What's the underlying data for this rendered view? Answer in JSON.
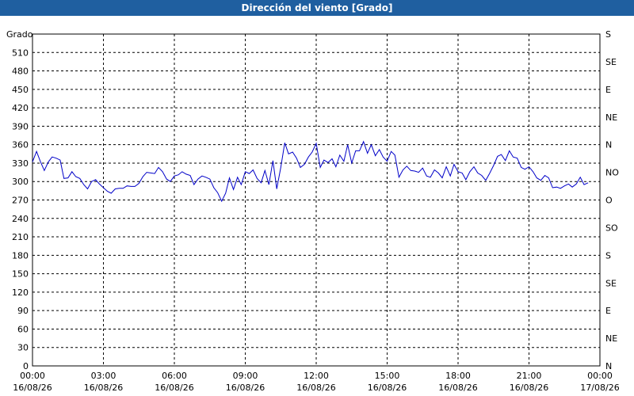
{
  "window": {
    "title": "Dirección del viento [Grado]"
  },
  "chart_data": {
    "type": "line",
    "ylabel": "Grado",
    "ylim": [
      0,
      540
    ],
    "yticks": [
      0,
      30,
      60,
      90,
      120,
      150,
      180,
      210,
      240,
      270,
      300,
      330,
      360,
      390,
      420,
      450,
      480,
      510
    ],
    "xlim": [
      0,
      24
    ],
    "x_unit": "hours since 16/08/26 00:00",
    "xticks": [
      {
        "x": 0,
        "time": "00:00",
        "date": "16/08/26"
      },
      {
        "x": 3,
        "time": "03:00",
        "date": "16/08/26"
      },
      {
        "x": 6,
        "time": "06:00",
        "date": "16/08/26"
      },
      {
        "x": 9,
        "time": "09:00",
        "date": "16/08/26"
      },
      {
        "x": 12,
        "time": "12:00",
        "date": "16/08/26"
      },
      {
        "x": 15,
        "time": "15:00",
        "date": "16/08/26"
      },
      {
        "x": 18,
        "time": "18:00",
        "date": "16/08/26"
      },
      {
        "x": 21,
        "time": "21:00",
        "date": "16/08/26"
      },
      {
        "x": 24,
        "time": "00:00",
        "date": "17/08/26"
      }
    ],
    "right_axis": [
      {
        "value": 0,
        "label": "N"
      },
      {
        "value": 45,
        "label": "NE"
      },
      {
        "value": 90,
        "label": "E"
      },
      {
        "value": 135,
        "label": "SE"
      },
      {
        "value": 180,
        "label": "S"
      },
      {
        "value": 225,
        "label": "SO"
      },
      {
        "value": 270,
        "label": "O"
      },
      {
        "value": 315,
        "label": "NO"
      },
      {
        "value": 360,
        "label": "N"
      },
      {
        "value": 405,
        "label": "NE"
      },
      {
        "value": 450,
        "label": "E"
      },
      {
        "value": 495,
        "label": "SE"
      },
      {
        "value": 540,
        "label": "S"
      }
    ],
    "grid": true,
    "series_color": "#0000c8",
    "series": [
      {
        "values": [
          [
            0.0,
            332
          ],
          [
            0.17,
            349
          ],
          [
            0.33,
            333
          ],
          [
            0.5,
            318
          ],
          [
            0.67,
            332
          ],
          [
            0.83,
            340
          ],
          [
            1.0,
            338
          ],
          [
            1.17,
            335
          ],
          [
            1.33,
            305
          ],
          [
            1.5,
            306
          ],
          [
            1.67,
            316
          ],
          [
            1.83,
            308
          ],
          [
            2.0,
            305
          ],
          [
            2.17,
            295
          ],
          [
            2.33,
            288
          ],
          [
            2.5,
            300
          ],
          [
            2.67,
            303
          ],
          [
            2.83,
            296
          ],
          [
            3.0,
            290
          ],
          [
            3.17,
            284
          ],
          [
            3.33,
            281
          ],
          [
            3.5,
            288
          ],
          [
            3.67,
            289
          ],
          [
            3.83,
            289
          ],
          [
            4.0,
            293
          ],
          [
            4.17,
            292
          ],
          [
            4.33,
            292
          ],
          [
            4.5,
            297
          ],
          [
            4.67,
            308
          ],
          [
            4.83,
            315
          ],
          [
            5.0,
            314
          ],
          [
            5.17,
            313
          ],
          [
            5.33,
            323
          ],
          [
            5.5,
            316
          ],
          [
            5.67,
            304
          ],
          [
            5.83,
            300
          ],
          [
            6.0,
            309
          ],
          [
            6.17,
            311
          ],
          [
            6.33,
            316
          ],
          [
            6.5,
            312
          ],
          [
            6.67,
            310
          ],
          [
            6.83,
            295
          ],
          [
            7.0,
            304
          ],
          [
            7.17,
            309
          ],
          [
            7.33,
            307
          ],
          [
            7.5,
            304
          ],
          [
            7.67,
            290
          ],
          [
            7.83,
            282
          ],
          [
            8.0,
            268
          ],
          [
            8.17,
            281
          ],
          [
            8.33,
            306
          ],
          [
            8.5,
            287
          ],
          [
            8.67,
            307
          ],
          [
            8.83,
            295
          ],
          [
            9.0,
            316
          ],
          [
            9.17,
            313
          ],
          [
            9.33,
            319
          ],
          [
            9.5,
            305
          ],
          [
            9.67,
            298
          ],
          [
            9.83,
            318
          ],
          [
            10.0,
            295
          ],
          [
            10.17,
            334
          ],
          [
            10.33,
            288
          ],
          [
            10.5,
            323
          ],
          [
            10.67,
            363
          ],
          [
            10.83,
            345
          ],
          [
            11.0,
            348
          ],
          [
            11.17,
            338
          ],
          [
            11.33,
            323
          ],
          [
            11.5,
            328
          ],
          [
            11.67,
            340
          ],
          [
            11.83,
            348
          ],
          [
            12.0,
            362
          ],
          [
            12.17,
            323
          ],
          [
            12.33,
            335
          ],
          [
            12.5,
            331
          ],
          [
            12.67,
            337
          ],
          [
            12.83,
            324
          ],
          [
            13.0,
            343
          ],
          [
            13.17,
            333
          ],
          [
            13.33,
            360
          ],
          [
            13.5,
            330
          ],
          [
            13.67,
            350
          ],
          [
            13.83,
            350
          ],
          [
            14.0,
            365
          ],
          [
            14.17,
            346
          ],
          [
            14.33,
            360
          ],
          [
            14.5,
            342
          ],
          [
            14.67,
            352
          ],
          [
            14.83,
            340
          ],
          [
            15.0,
            333
          ],
          [
            15.17,
            349
          ],
          [
            15.33,
            343
          ],
          [
            15.5,
            307
          ],
          [
            15.67,
            319
          ],
          [
            15.83,
            325
          ],
          [
            16.0,
            318
          ],
          [
            16.17,
            317
          ],
          [
            16.33,
            315
          ],
          [
            16.5,
            322
          ],
          [
            16.67,
            309
          ],
          [
            16.83,
            307
          ],
          [
            17.0,
            319
          ],
          [
            17.17,
            314
          ],
          [
            17.33,
            306
          ],
          [
            17.5,
            324
          ],
          [
            17.67,
            309
          ],
          [
            17.83,
            328
          ],
          [
            18.0,
            316
          ],
          [
            18.17,
            314
          ],
          [
            18.33,
            303
          ],
          [
            18.5,
            316
          ],
          [
            18.67,
            324
          ],
          [
            18.83,
            314
          ],
          [
            19.0,
            310
          ],
          [
            19.17,
            302
          ],
          [
            19.33,
            313
          ],
          [
            19.5,
            326
          ],
          [
            19.67,
            341
          ],
          [
            19.83,
            344
          ],
          [
            20.0,
            334
          ],
          [
            20.17,
            350
          ],
          [
            20.33,
            340
          ],
          [
            20.5,
            338
          ],
          [
            20.67,
            323
          ],
          [
            20.83,
            320
          ],
          [
            21.0,
            324
          ],
          [
            21.17,
            316
          ],
          [
            21.33,
            306
          ],
          [
            21.5,
            302
          ],
          [
            21.67,
            310
          ],
          [
            21.83,
            306
          ],
          [
            22.0,
            290
          ],
          [
            22.17,
            291
          ],
          [
            22.33,
            289
          ],
          [
            22.5,
            293
          ],
          [
            22.67,
            296
          ],
          [
            22.83,
            291
          ],
          [
            23.0,
            296
          ],
          [
            23.17,
            307
          ],
          [
            23.33,
            295
          ],
          [
            23.5,
            298
          ]
        ]
      }
    ]
  }
}
